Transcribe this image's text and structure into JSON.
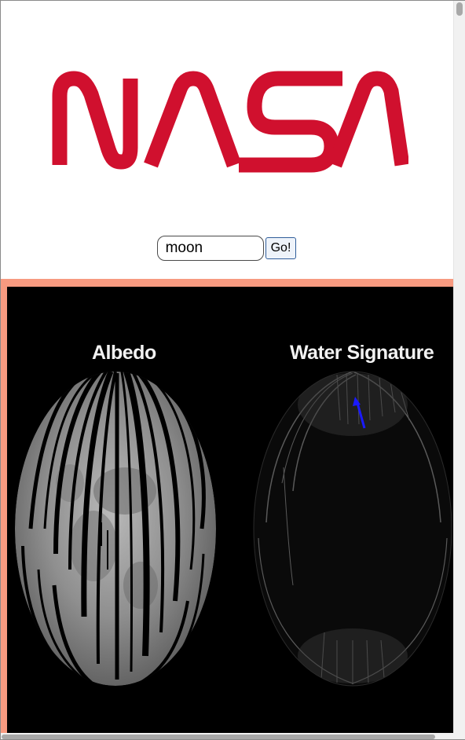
{
  "logo": {
    "text": "NASA",
    "icon": "nasa-worm-logo",
    "color": "#d0102e"
  },
  "search": {
    "value": "moon",
    "button_label": "Go!"
  },
  "result": {
    "panel_color": "#f79a80",
    "image": {
      "left_label": "Albedo",
      "right_label": "Water Signature",
      "marker_icon": "blue-arrow-icon",
      "marker_color": "#1a1aff"
    }
  }
}
